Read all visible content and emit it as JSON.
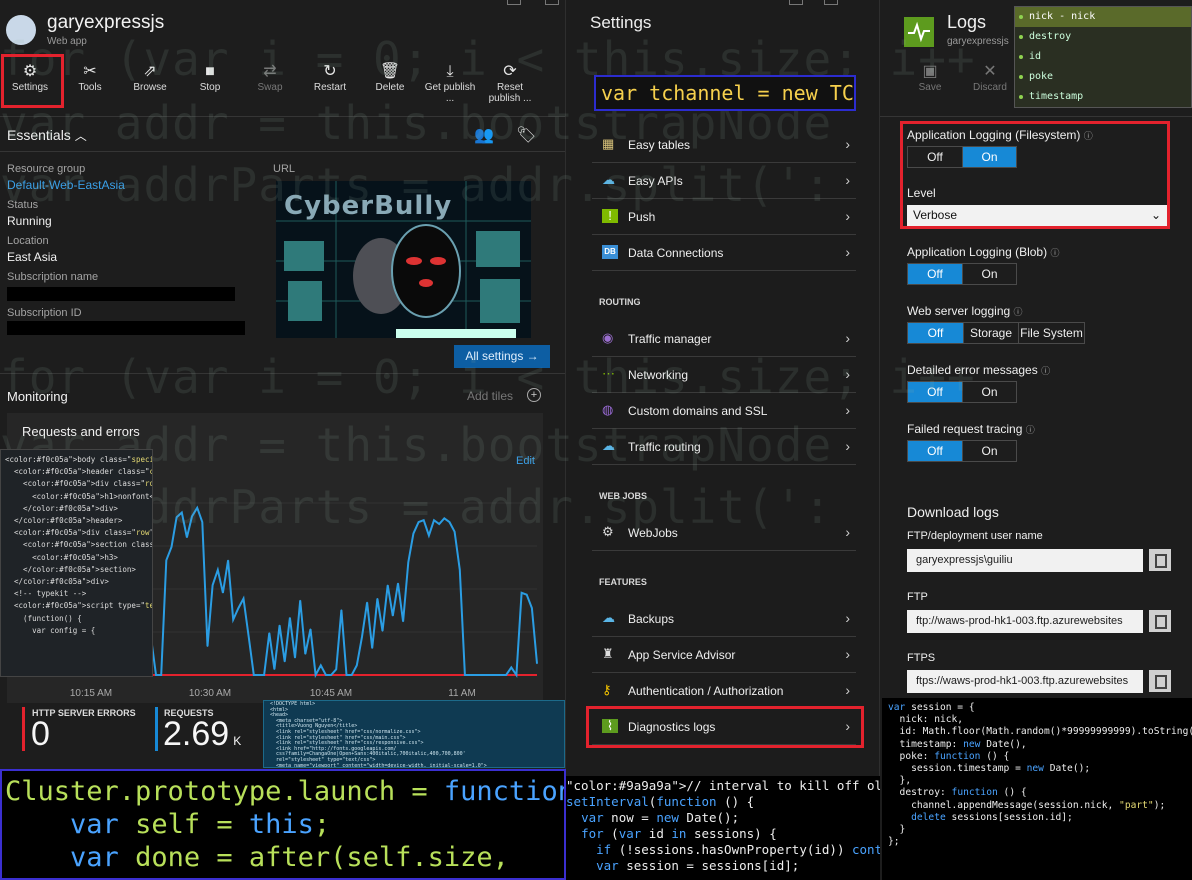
{
  "colors": {
    "accent": "#1789d6",
    "highlight": "#e3222d",
    "link": "#3aa0e8",
    "chart_line": "#2b9de3"
  },
  "bg_code": {
    "line1": "for (var i = 0; i < this.size; i++",
    "line2": "var addr = this.bootstrapNode",
    "line3": "var addrParts = addr.split(':"
  },
  "app": {
    "title": "garyexpressjs",
    "subtitle": "Web app"
  },
  "toolbar": [
    {
      "label": "Settings",
      "icon": "gear-icon",
      "glyph": "⚙"
    },
    {
      "label": "Tools",
      "icon": "tools-icon",
      "glyph": "✂"
    },
    {
      "label": "Browse",
      "icon": "browse-icon",
      "glyph": "⇗"
    },
    {
      "label": "Stop",
      "icon": "stop-icon",
      "glyph": "■"
    },
    {
      "label": "Swap",
      "icon": "swap-icon",
      "glyph": "⇄"
    },
    {
      "label": "Restart",
      "icon": "restart-icon",
      "glyph": "↻"
    },
    {
      "label": "Delete",
      "icon": "delete-icon",
      "glyph": "🗑"
    },
    {
      "label": "Get publish ...",
      "icon": "download-icon",
      "glyph": "⤓"
    },
    {
      "label": "Reset publish ...",
      "icon": "reset-icon",
      "glyph": "⟳"
    }
  ],
  "essentials": {
    "title": "Essentials",
    "resource_group_label": "Resource group",
    "resource_group": "Default-Web-EastAsia",
    "status_label": "Status",
    "status": "Running",
    "location_label": "Location",
    "location": "East Asia",
    "subscription_name_label": "Subscription name",
    "subscription_id_label": "Subscription ID",
    "url_label": "URL",
    "all_settings": "All settings →"
  },
  "image_overlay": {
    "caption": "CyberBully"
  },
  "monitoring": {
    "title": "Monitoring",
    "add_tiles": "Add tiles",
    "chart_title": "Requests and errors",
    "edit": "Edit"
  },
  "chart_data": {
    "type": "line",
    "title": "Requests and errors",
    "x_ticks": [
      "10:15 AM",
      "10:30 AM",
      "10:45 AM",
      "11 AM"
    ],
    "series": [
      {
        "values": [
          0,
          0,
          42,
          18,
          70,
          0,
          0,
          38,
          2,
          1,
          22,
          14,
          26,
          30,
          8,
          0,
          0,
          18,
          62,
          20,
          36,
          18,
          54,
          82,
          92,
          88,
          40,
          0,
          0,
          120,
          134,
          165,
          170,
          144,
          166,
          175,
          160,
          30,
          94,
          110,
          86,
          120,
          58,
          70,
          80,
          40,
          0,
          0,
          0,
          44,
          6,
          52,
          14,
          60,
          18,
          78,
          22,
          48,
          0,
          10,
          0,
          0,
          6,
          68,
          0,
          0,
          10,
          40,
          76,
          28,
          80,
          46,
          94,
          62,
          96,
          56,
          118,
          148,
          160,
          162,
          146,
          162,
          158,
          164,
          160,
          150,
          110,
          0,
          0,
          0,
          0,
          0,
          0,
          0,
          0,
          0,
          8,
          0,
          86,
          84,
          70,
          12
        ]
      },
      {
        "values": [
          0,
          0,
          0,
          0,
          0,
          0,
          0,
          0,
          0,
          0,
          0,
          0,
          0,
          0,
          0,
          0,
          0,
          0,
          0,
          0,
          0,
          0,
          0,
          0,
          0,
          0,
          0,
          0,
          0,
          0,
          0,
          0,
          0,
          0,
          0,
          0,
          0,
          0,
          0,
          0,
          0,
          0,
          0,
          0,
          0,
          0,
          0,
          0,
          0,
          0,
          0,
          0,
          0,
          0,
          0,
          0,
          0,
          0,
          0,
          0,
          0,
          0,
          0,
          0,
          0,
          0,
          0,
          0,
          0,
          0,
          0,
          0,
          0,
          0,
          0,
          0,
          0,
          0,
          0,
          0,
          0,
          0,
          0,
          0,
          0,
          0,
          0,
          0,
          0,
          0,
          0,
          0,
          0,
          0,
          0,
          0,
          0,
          0,
          0,
          0,
          0,
          0
        ]
      }
    ]
  },
  "stats": {
    "errors_label": "HTTP SERVER ERRORS",
    "errors": "0",
    "requests_label": "REQUESTS",
    "requests": "2.69",
    "requests_unit": "K"
  },
  "settings": {
    "title": "Settings",
    "code_banner": "var tchannel = new TChannel();",
    "rows_top": [
      {
        "label": "Easy tables",
        "icon": "table-icon",
        "glyph": "▦",
        "color": "#d8c27a"
      },
      {
        "label": "Easy APIs",
        "icon": "cloud-icon",
        "glyph": "☁",
        "color": "#5ab5e6"
      },
      {
        "label": "Push",
        "icon": "push-icon",
        "glyph": "!",
        "color": "#7fba00"
      },
      {
        "label": "Data Connections",
        "icon": "database-icon",
        "glyph": "DB",
        "color": "#3a8fd6"
      }
    ],
    "routing_label": "ROUTING",
    "rows_routing": [
      {
        "label": "Traffic manager",
        "icon": "traffic-manager-icon",
        "glyph": "◉",
        "color": "#9b6fcf"
      },
      {
        "label": "Networking",
        "icon": "networking-icon",
        "glyph": "⋯",
        "color": "#7fba00"
      },
      {
        "label": "Custom domains and SSL",
        "icon": "globe-icon",
        "glyph": "◍",
        "color": "#9a6bd6"
      },
      {
        "label": "Traffic routing",
        "icon": "cloud-icon",
        "glyph": "☁",
        "color": "#5ab5e6"
      }
    ],
    "webjobs_label": "WEB JOBS",
    "rows_webjobs": [
      {
        "label": "WebJobs",
        "icon": "webjobs-icon",
        "glyph": "⚙",
        "color": "#dddddd"
      }
    ],
    "features_label": "FEATURES",
    "rows_features": [
      {
        "label": "Backups",
        "icon": "cloud-icon",
        "glyph": "☁",
        "color": "#5ab5e6"
      },
      {
        "label": "App Service Advisor",
        "icon": "advisor-icon",
        "glyph": "♜",
        "color": "#dddddd"
      },
      {
        "label": "Authentication / Authorization",
        "icon": "key-icon",
        "glyph": "⚷",
        "color": "#f5c400"
      },
      {
        "label": "Diagnostics logs",
        "icon": "diagnostics-icon",
        "glyph": "⌇",
        "color": "#5d9b1e"
      }
    ]
  },
  "logs": {
    "title": "Logs",
    "subtitle": "garyexpressjs",
    "save": "Save",
    "discard": "Discard",
    "app_fs_label": "Application Logging (Filesystem)",
    "off": "Off",
    "on": "On",
    "level_label": "Level",
    "level_value": "Verbose",
    "app_blob_label": "Application Logging (Blob)",
    "web_server_label": "Web server logging",
    "storage": "Storage",
    "file_system": "File System",
    "detailed_label": "Detailed error messages",
    "failed_label": "Failed request tracing",
    "download_title": "Download logs",
    "ftp_user_label": "FTP/deployment user name",
    "ftp_user": "garyexpressjs\\guiliu",
    "ftp_label": "FTP",
    "ftp": "ftp://waws-prod-hk1-003.ftp.azurewebsites",
    "ftps_label": "FTPS",
    "ftps": "ftps://waws-prod-hk1-003.ftp.azurewebsites"
  },
  "autocomplete": {
    "items": [
      "nick - nick",
      "destroy",
      "id",
      "poke",
      "timestamp"
    ]
  },
  "code_html": [
    "<body class=\"special-project\">",
    "",
    "  <header class=\"cutout container noise\">",
    "    <div class=\"row\">",
    "      <h1>nonfont</h1>",
    "    </div>",
    "  </header>",
    "",
    "  <div class=\"row\">",
    "    <section class=\"one-half\">",
    "      <h3>",
    "    </section>",
    "  </div>",
    "",
    "  <!-- typekit -->",
    "  <script type=\"text/javascript\">",
    "    (function() {",
    "      var config = {"
  ],
  "code_head": [
    "<!DOCTYPE html>",
    "<html>",
    "<head>",
    "  <meta charset=\"utf-8\">",
    "  <title>Vuong Nguyen</title>",
    "  <link rel=\"stylesheet\" href=\"css/normalize.css\">",
    "  <link rel=\"stylesheet\" href=\"css/main.css\">",
    "  <link rel=\"stylesheet\" href=\"css/responsive.css\">",
    "  <link href=\"http://fonts.googleapis.com/",
    "  css?family=ChangaOne|Open+Sans:400italic,700italic,400,700,800'",
    "  rel=\"stylesheet\" type=\"text/css\">",
    "  <meta name=\"viewport\" content=\"width=device-width, initial-scale=1.0\">",
    "</head>",
    "<body>"
  ],
  "code_cluster": [
    "Cluster.prototype.launch = function",
    "    var self = this;",
    "    var done = after(self.size,"
  ],
  "code_interval": [
    "// interval to kill off old sessions",
    "setInterval(function () {",
    "  var now = new Date();",
    "  for (var id in sessions) {",
    "    if (!sessions.hasOwnProperty(id)) continue;",
    "    var session = sessions[id];"
  ],
  "code_session": [
    "var session = {",
    "  nick: nick,",
    "  id: Math.floor(Math.random()*99999999999).toString(),",
    "  timestamp: new Date(),",
    "",
    "  poke: function () {",
    "    session.timestamp = new Date();",
    "  },",
    "",
    "  destroy: function () {",
    "    channel.appendMessage(session.nick, \"part\");",
    "    delete sessions[session.id];",
    "  }",
    "};"
  ]
}
